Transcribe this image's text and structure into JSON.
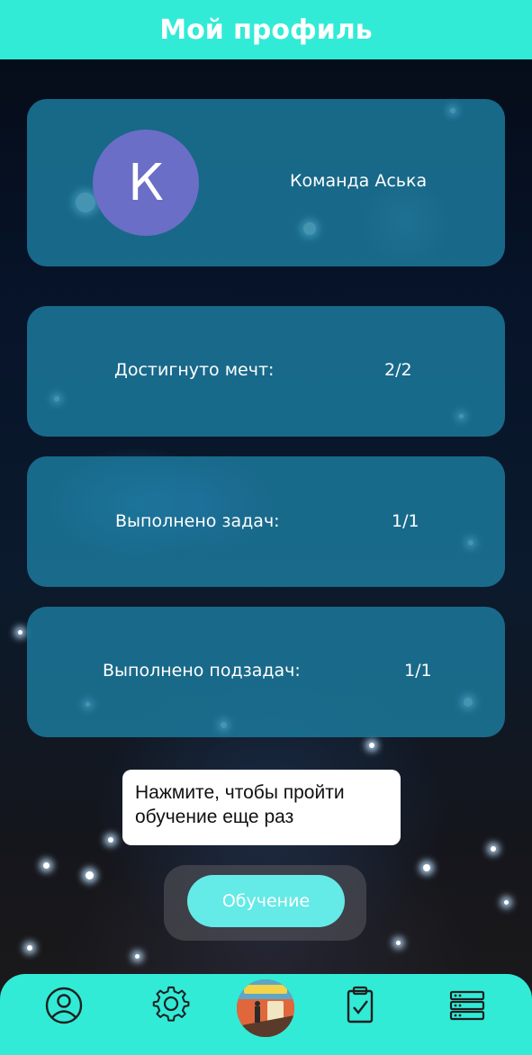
{
  "header": {
    "title": "Мой профиль"
  },
  "profile": {
    "avatar_letter": "К",
    "team_name": "Команда Аська"
  },
  "stats": [
    {
      "label": "Достигнуто мечт:",
      "value": "2/2"
    },
    {
      "label": "Выполнено задач:",
      "value": "1/1"
    },
    {
      "label": "Выполнено подзадач:",
      "value": "1/1"
    }
  ],
  "tooltip": {
    "line1": "Нажмите, чтобы пройти",
    "line2": "обучение еще раз"
  },
  "training_button": {
    "label": "Обучение"
  },
  "bottom_nav": {
    "items": [
      "profile-icon",
      "settings-gear-icon",
      "dreams-app-icon",
      "tasks-clipboard-icon",
      "list-icon"
    ]
  },
  "colors": {
    "accent": "#31ebd7",
    "card": "#1c7ca0",
    "avatar": "#6a6ec7",
    "button": "#64eae7"
  }
}
